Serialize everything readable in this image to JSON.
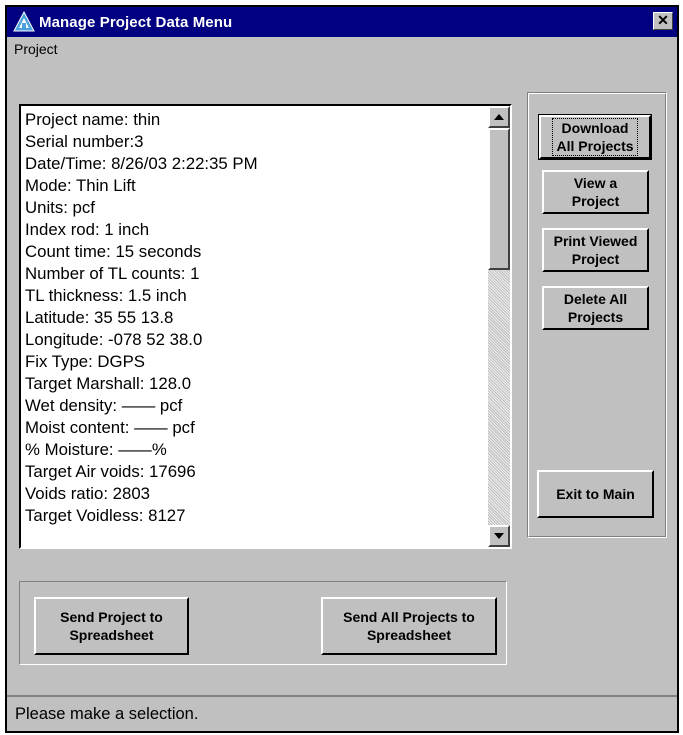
{
  "window": {
    "title": "Manage Project Data Menu",
    "close_glyph": "✕"
  },
  "menu": {
    "items": [
      "Project"
    ]
  },
  "project_list": {
    "lines": [
      "Project name: thin",
      "Serial number:3",
      "Date/Time: 8/26/03 2:22:35 PM",
      "Mode: Thin Lift",
      "Units: pcf",
      "Index rod: 1 inch",
      "Count time: 15 seconds",
      "Number of TL counts: 1",
      "TL thickness: 1.5 inch",
      "Latitude: 35 55 13.8",
      "Longitude: -078 52 38.0",
      "Fix Type: DGPS",
      "Target Marshall: 128.0",
      "Wet density: —— pcf",
      "Moist content: —— pcf",
      "% Moisture: ——%",
      "Target Air voids: 17696",
      "Voids ratio: 2803",
      "Target Voidless: 8127"
    ]
  },
  "side_buttons": {
    "download": "Download\nAll Projects",
    "view": "View a\nProject",
    "print": "Print Viewed\nProject",
    "delete": "Delete All\nProjects",
    "exit": "Exit to Main"
  },
  "bottom_buttons": {
    "send_one": "Send Project to\nSpreadsheet",
    "send_all": "Send All Projects to\nSpreadsheet"
  },
  "status": {
    "text": "Please make a selection."
  },
  "colors": {
    "titlebar": "#000080",
    "face": "#c0c0c0"
  },
  "icons": {
    "app": "triangle-app-icon",
    "scroll_up": "arrow-up-icon",
    "scroll_down": "arrow-down-icon"
  }
}
